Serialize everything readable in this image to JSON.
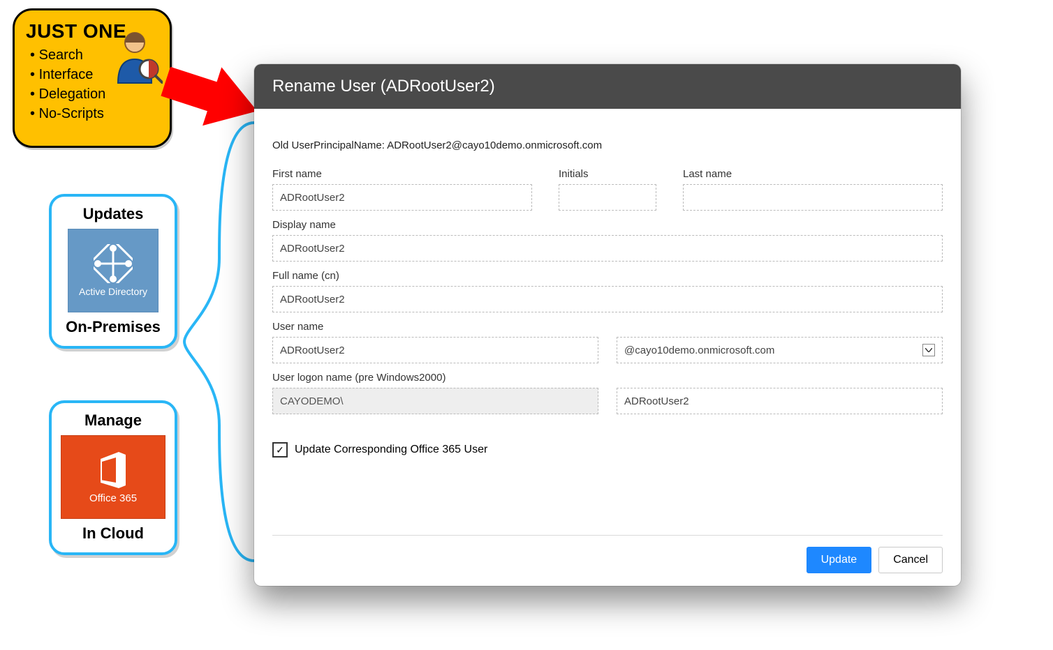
{
  "yellow": {
    "title": "JUST ONE",
    "bullets": [
      "Search",
      "Interface",
      "Delegation",
      "No-Scripts"
    ]
  },
  "cards": {
    "updates": {
      "heading": "Updates",
      "tile_label": "Active Directory",
      "sub": "On-Premises"
    },
    "manage": {
      "heading": "Manage",
      "tile_label": "Office 365",
      "sub": "In Cloud"
    }
  },
  "dialog": {
    "title": "Rename User (ADRootUser2)",
    "old_upn_label": "Old UserPrincipalName: ADRootUser2@cayo10demo.onmicrosoft.com",
    "labels": {
      "first_name": "First name",
      "initials": "Initials",
      "last_name": "Last name",
      "display_name": "Display name",
      "full_name": "Full name (cn)",
      "user_name": "User name",
      "logon_pre2000": "User logon name (pre Windows2000)"
    },
    "values": {
      "first_name": "ADRootUser2",
      "initials": "",
      "last_name": "",
      "display_name": "ADRootUser2",
      "full_name": "ADRootUser2",
      "user_name": "ADRootUser2",
      "domain": "@cayo10demo.onmicrosoft.com",
      "pre2000_domain": "CAYODEMO\\",
      "pre2000_user": "ADRootUser2"
    },
    "checkbox_label": "Update Corresponding Office 365 User",
    "checkbox_checked": true,
    "buttons": {
      "update": "Update",
      "cancel": "Cancel"
    }
  }
}
